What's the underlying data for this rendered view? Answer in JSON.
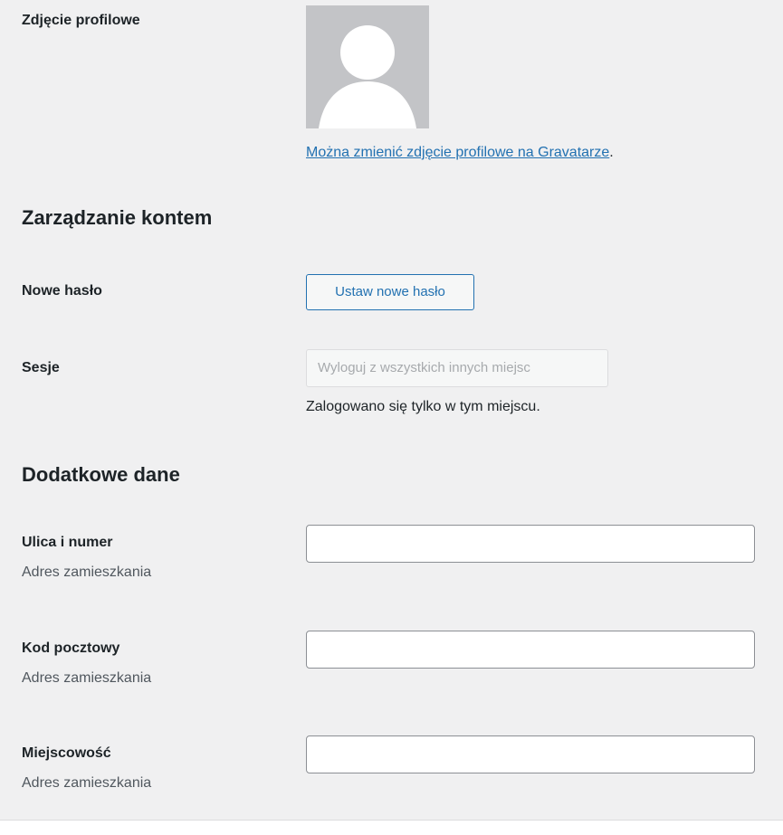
{
  "profile_picture": {
    "label": "Zdjęcie profilowe",
    "avatar_icon": "default-user-silhouette-icon",
    "link_text": "Można zmienić zdjęcie profilowe na Gravatarze",
    "link_suffix": "."
  },
  "account_management": {
    "heading": "Zarządzanie kontem",
    "new_password": {
      "label": "Nowe hasło",
      "button_label": "Ustaw nowe hasło"
    },
    "sessions": {
      "label": "Sesje",
      "button_label": "Wyloguj z wszystkich innych miejsc",
      "note": "Zalogowano się tylko w tym miejscu."
    }
  },
  "additional_data": {
    "heading": "Dodatkowe dane",
    "fields": [
      {
        "label": "Ulica i numer",
        "description": "Adres zamieszkania",
        "value": ""
      },
      {
        "label": "Kod pocztowy",
        "description": "Adres zamieszkania",
        "value": ""
      },
      {
        "label": "Miejscowość",
        "description": "Adres zamieszkania",
        "value": ""
      }
    ]
  },
  "colors": {
    "background": "#f0f0f1",
    "link": "#2271b1",
    "avatar_bg": "#c3c4c7",
    "text": "#1d2327",
    "muted_text": "#50575e"
  }
}
